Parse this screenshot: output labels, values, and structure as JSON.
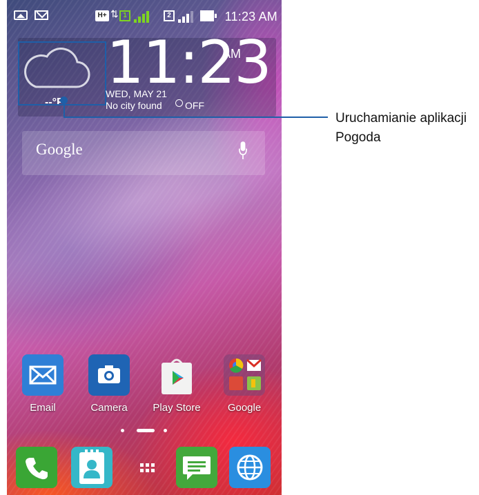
{
  "status_bar": {
    "time": "11:23 AM",
    "network_type": "H+",
    "sim1_label": "1",
    "sim2_label": "2",
    "icons": [
      "picture-notification-icon",
      "gmail-notification-icon",
      "data-arrows-icon",
      "sim1-icon",
      "signal-bars-icon",
      "sim2-icon",
      "signal-bars-icon",
      "battery-icon"
    ]
  },
  "clock_widget": {
    "time": "11:23",
    "ampm": "AM",
    "date": "WED, MAY 21",
    "city": "No city found",
    "alarm_status": "OFF",
    "temperature": "--°F",
    "weather_icon": "cloud-icon"
  },
  "search": {
    "logo_text": "Google",
    "mic_icon": "microphone-icon"
  },
  "apps": [
    {
      "label": "Email",
      "icon": "email-icon",
      "color": "#2f7fd6"
    },
    {
      "label": "Camera",
      "icon": "camera-icon",
      "color": "#1f64b4"
    },
    {
      "label": "Play Store",
      "icon": "play-store-icon",
      "color": "#f2f2f2"
    },
    {
      "label": "Google",
      "icon": "google-folder-icon",
      "color": "#7a4a76"
    }
  ],
  "dock": [
    {
      "icon": "phone-icon",
      "color": "#3aa635"
    },
    {
      "icon": "contacts-icon",
      "color": "#35b7c8"
    },
    {
      "icon": "app-drawer-icon",
      "color": ""
    },
    {
      "icon": "messaging-icon",
      "color": "#43a83c"
    },
    {
      "icon": "browser-icon",
      "color": "#2a8ee0"
    }
  ],
  "callout": {
    "text": "Uruchamianie aplikacji Pogoda"
  },
  "colors": {
    "callout": "#1e5fa8",
    "signal_sim1": "#7ed321"
  }
}
